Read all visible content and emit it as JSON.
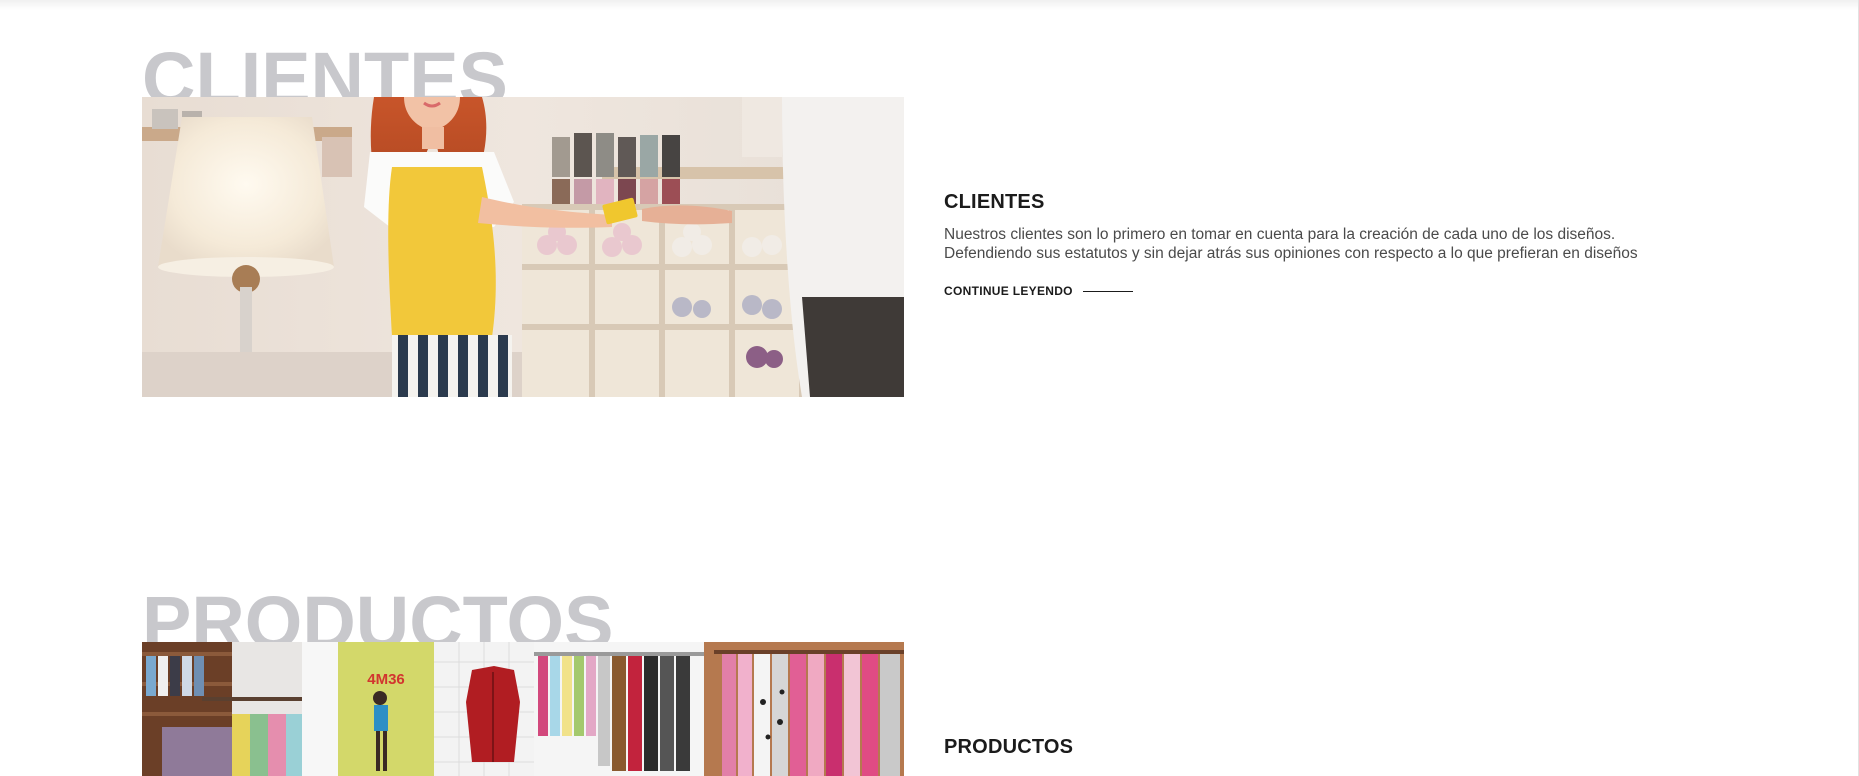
{
  "sections": [
    {
      "bg_title": "CLIENTES",
      "heading": "CLIENTES",
      "body": [
        "Nuestros clientes son lo primero en tomar en cuenta para la creación de cada uno de los diseños.",
        "Defendiendo sus estatutos y sin dejar atrás sus opiniones con respecto a lo que prefieran en diseños"
      ],
      "link_label": "CONTINUE LEYENDO",
      "image": "photo of a customer in a yellow top paying with a card in a yarn shop"
    },
    {
      "bg_title": "PRODUCTOS",
      "heading": "PRODUCTOS",
      "poster_text": "4M36",
      "image": "photo of a clothing store interior with shirts on hanging racks"
    }
  ],
  "colors": {
    "bg_title": "#c8c8cc",
    "heading": "#1b1b1b",
    "body": "#4a4a4a",
    "shirt_yellow": "#f2c83a"
  }
}
